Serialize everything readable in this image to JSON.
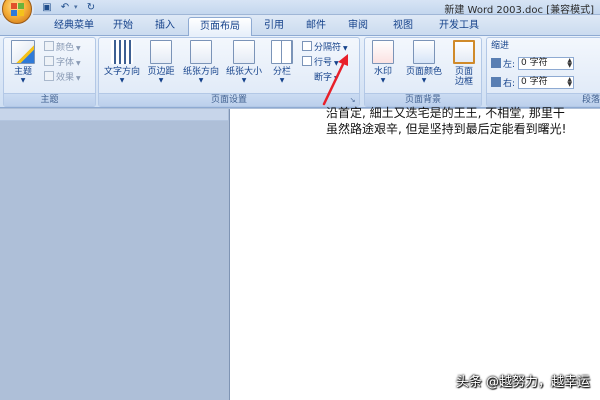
{
  "window": {
    "title": "新建 Word 2003.doc [兼容模式]"
  },
  "quick_access": {
    "save_icon": "save-icon",
    "undo_icon": "undo-icon",
    "redo_icon": "redo-icon"
  },
  "tabs": [
    {
      "label": "经典菜单"
    },
    {
      "label": "开始"
    },
    {
      "label": "插入"
    },
    {
      "label": "页面布局",
      "active": true
    },
    {
      "label": "引用"
    },
    {
      "label": "邮件"
    },
    {
      "label": "审阅"
    },
    {
      "label": "视图"
    },
    {
      "label": "开发工具"
    }
  ],
  "ribbon": {
    "theme_group": {
      "label": "主题",
      "theme_button": "主题",
      "colors": "颜色",
      "fonts": "字体",
      "effects": "效果"
    },
    "page_setup_group": {
      "label": "页面设置",
      "text_direction": "文字方向",
      "margins": "页边距",
      "orientation": "纸张方向",
      "size": "纸张大小",
      "columns": "分栏",
      "breaks": "分隔符",
      "line_numbers": "行号",
      "hyphenation": "断字"
    },
    "page_background_group": {
      "label": "页面背景",
      "watermark": "水印",
      "page_color": "页面颜色",
      "page_border_line1": "页面",
      "page_border_line2": "边框"
    },
    "paragraph_group": {
      "label": "段落",
      "indent_title": "缩进",
      "left_label": "左:",
      "left_value": "0 字符",
      "right_label": "右:",
      "right_value": "0 字符"
    }
  },
  "document": {
    "line1": "沿首定, 細土又迭宅是的王王, 不相堂, 那里干",
    "line2": "虽然路途艰辛, 但是坚持到最后定能看到曙光!"
  },
  "overlay": {
    "watermark_text": "头条 @越努力，越幸运",
    "arrow_color": "#e8202a"
  },
  "colors": {
    "ribbon_text": "#15428b",
    "workspace": "#aebfd8"
  }
}
